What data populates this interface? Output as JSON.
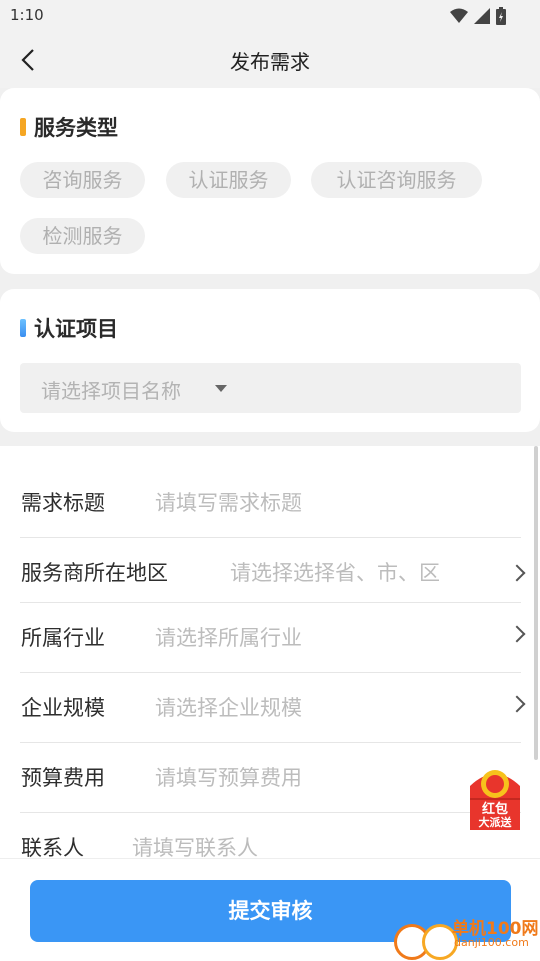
{
  "status_bar": {
    "time": "1:10"
  },
  "header": {
    "title": "发布需求"
  },
  "service_type": {
    "title": "服务类型",
    "accent_color": "#f5a623",
    "chips": [
      "咨询服务",
      "认证服务",
      "认证咨询服务",
      "检测服务"
    ]
  },
  "cert_project": {
    "title": "认证项目",
    "accent_color": "#3a96f5",
    "select_placeholder": "请选择项目名称"
  },
  "form": {
    "rows": [
      {
        "label": "需求标题",
        "placeholder": "请填写需求标题"
      },
      {
        "label": "服务商所在地区",
        "placeholder": "请选择选择省、市、区"
      },
      {
        "label": "所属行业",
        "placeholder": "请选择所属行业"
      },
      {
        "label": "企业规模",
        "placeholder": "请选择企业规模"
      },
      {
        "label": "预算费用",
        "placeholder": "请填写预算费用"
      },
      {
        "label": "联系人",
        "placeholder": "请填写联系人"
      }
    ]
  },
  "submit": {
    "label": "提交审核",
    "color": "#3a96f5"
  },
  "red_packet": {
    "line1": "红包",
    "line2": "大派送"
  },
  "watermark": {
    "name": "单机100网",
    "url": "danji100.com"
  }
}
